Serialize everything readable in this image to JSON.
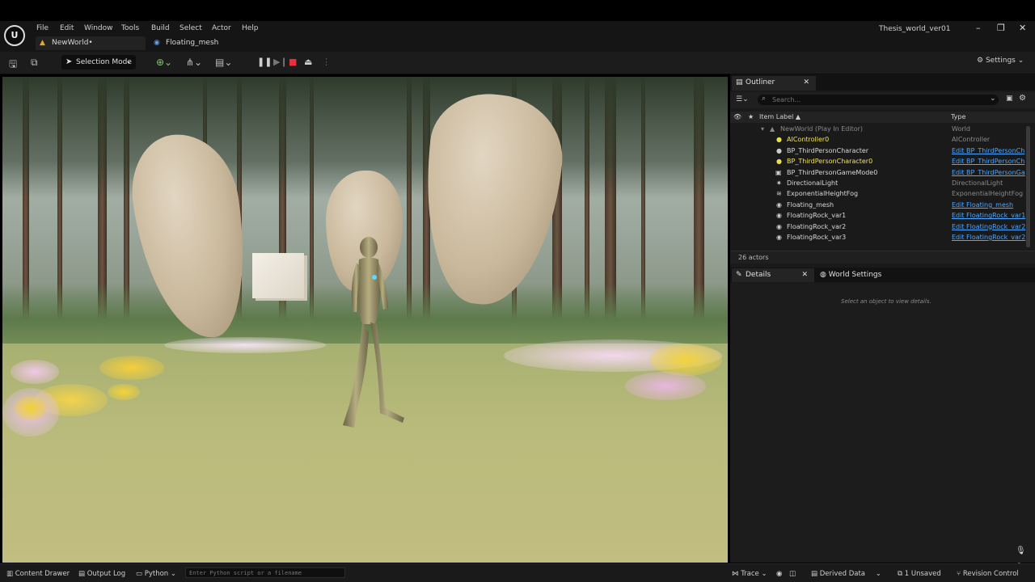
{
  "app": {
    "window_title": "Thesis_world_ver01",
    "logo_icon": "unreal-logo-icon"
  },
  "menu": [
    "File",
    "Edit",
    "Window",
    "Tools",
    "Build",
    "Select",
    "Actor",
    "Help"
  ],
  "tabs": [
    {
      "label": "NewWorld•",
      "icon": "level-icon",
      "active": true
    },
    {
      "label": "Floating_mesh",
      "icon": "blueprint-icon",
      "active": false
    }
  ],
  "toolbar": {
    "selection_mode": "Selection Mode",
    "settings": "Settings"
  },
  "outliner": {
    "tab_label": "Outliner",
    "search_placeholder": "Search...",
    "col_label": "Item Label ▲",
    "col_type": "Type",
    "rows": [
      {
        "label": "NewWorld (Play In Editor)",
        "type": "World",
        "link": false,
        "dim": true,
        "indent": 0
      },
      {
        "label": "AIController0",
        "type": "AIController",
        "link": false,
        "yellow": true,
        "indent": 1
      },
      {
        "label": "BP_ThirdPersonCharacter",
        "type": "Edit BP_ThirdPersonCh",
        "link": true,
        "indent": 1
      },
      {
        "label": "BP_ThirdPersonCharacter0",
        "type": "Edit BP_ThirdPersonCh",
        "link": true,
        "yellow": true,
        "indent": 1
      },
      {
        "label": "BP_ThirdPersonGameMode0",
        "type": "Edit BP_ThirdPersonGa",
        "link": true,
        "indent": 1
      },
      {
        "label": "DirectionalLight",
        "type": "DirectionalLight",
        "link": false,
        "indent": 1
      },
      {
        "label": "ExponentialHeightFog",
        "type": "ExponentialHeightFog",
        "link": false,
        "indent": 1
      },
      {
        "label": "Floating_mesh",
        "type": "Edit Floating_mesh",
        "link": true,
        "indent": 1
      },
      {
        "label": "FloatingRock_var1",
        "type": "Edit FloatingRock_var1",
        "link": true,
        "indent": 1
      },
      {
        "label": "FloatingRock_var2",
        "type": "Edit FloatingRock_var2",
        "link": true,
        "indent": 1
      },
      {
        "label": "FloatingRock_var3",
        "type": "Edit FloatingRock_var2",
        "link": true,
        "indent": 1
      }
    ],
    "actors_count": "26 actors"
  },
  "details": {
    "tab_label": "Details",
    "world_settings_label": "World Settings",
    "empty_text": "Select an object to view details."
  },
  "bottombar": {
    "content_drawer": "Content Drawer",
    "output_log": "Output Log",
    "python": "Python",
    "python_placeholder": "Enter Python script or a filename",
    "trace": "Trace",
    "derived_data": "Derived Data",
    "unsaved": "1 Unsaved",
    "revision_control": "Revision Control"
  }
}
